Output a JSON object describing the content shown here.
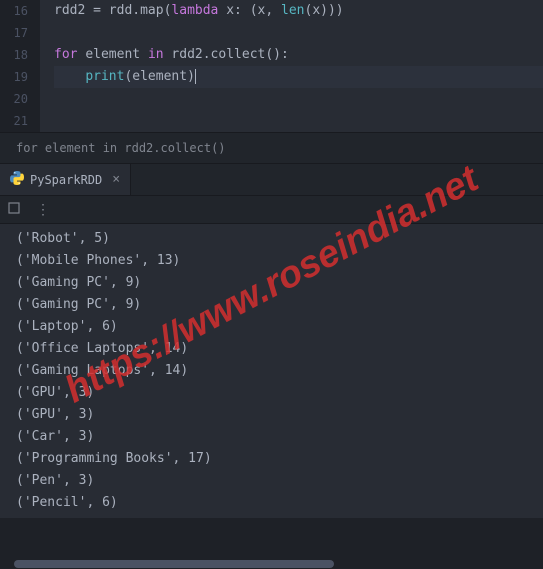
{
  "editor": {
    "lines": [
      {
        "num": "16",
        "tokens": [
          {
            "t": "rdd2 ",
            "c": "var"
          },
          {
            "t": "= ",
            "c": "var"
          },
          {
            "t": "rdd.map(",
            "c": "var"
          },
          {
            "t": "lambda ",
            "c": "kw-orange"
          },
          {
            "t": "x: (x, ",
            "c": "var"
          },
          {
            "t": "len",
            "c": "builtin"
          },
          {
            "t": "(x)))",
            "c": "var"
          }
        ]
      },
      {
        "num": "17",
        "tokens": []
      },
      {
        "num": "18",
        "tokens": [
          {
            "t": "for ",
            "c": "kw-orange"
          },
          {
            "t": "element ",
            "c": "var"
          },
          {
            "t": "in ",
            "c": "kw-orange"
          },
          {
            "t": "rdd2.collect():",
            "c": "var"
          }
        ]
      },
      {
        "num": "19",
        "highlight": true,
        "tokens": [
          {
            "t": "    ",
            "c": "var"
          },
          {
            "t": "print",
            "c": "builtin"
          },
          {
            "t": "(element)",
            "c": "var"
          }
        ],
        "cursor": true
      },
      {
        "num": "20",
        "tokens": []
      },
      {
        "num": "21",
        "tokens": []
      }
    ]
  },
  "breadcrumb": "for element in rdd2.collect()",
  "tab": {
    "label": "PySparkRDD"
  },
  "output": [
    "('Robot', 5)",
    "('Mobile Phones', 13)",
    "('Gaming PC', 9)",
    "('Gaming PC', 9)",
    "('Laptop', 6)",
    "('Office Laptops', 14)",
    "('Gaming Laptops', 14)",
    "('GPU', 3)",
    "('GPU', 3)",
    "('Car', 3)",
    "('Programming Books', 17)",
    "('Pen', 3)",
    "('Pencil', 6)"
  ],
  "watermark": "https://www.roseindia.net"
}
